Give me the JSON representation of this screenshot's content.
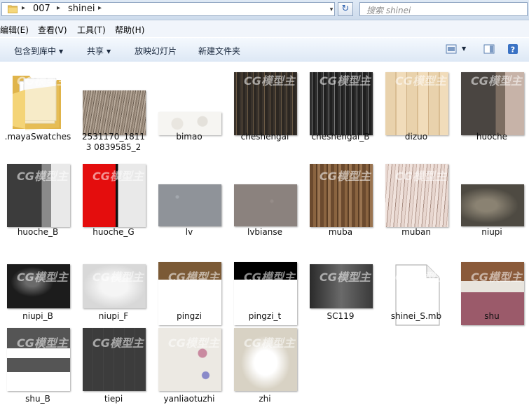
{
  "address": {
    "crumbs": [
      "007",
      "shinei"
    ],
    "separator": "▸",
    "dropdown": "▾",
    "refresh": "↻"
  },
  "search": {
    "placeholder": "搜索 shinei"
  },
  "menu": {
    "items": [
      "编辑(E)",
      "查看(V)",
      "工具(T)",
      "帮助(H)"
    ]
  },
  "toolbar": {
    "include_in_library": "包含到库中",
    "share": "共享",
    "slideshow": "放映幻灯片",
    "new_folder": "新建文件夹",
    "view_icon": "view-options-icon",
    "pane_icon": "preview-pane-icon",
    "help_icon": "help-icon"
  },
  "watermark": "CG模型主",
  "files": [
    {
      "name": ".mayaSwatches",
      "kind": "folder"
    },
    {
      "name": "2531170_18113 0839585_2",
      "kind": "image",
      "texture": "fur"
    },
    {
      "name": "bimao",
      "kind": "image",
      "texture": "bimao"
    },
    {
      "name": "cheshengai",
      "kind": "image",
      "texture": "cheshengai"
    },
    {
      "name": "cheshengai_B",
      "kind": "image",
      "texture": "cheshengai_b"
    },
    {
      "name": "dizuo",
      "kind": "image",
      "texture": "dizuo"
    },
    {
      "name": "huoche",
      "kind": "image",
      "texture": "huoche"
    },
    {
      "name": "huoche_B",
      "kind": "image",
      "texture": "huoche_b"
    },
    {
      "name": "huoche_G",
      "kind": "image",
      "texture": "huoche_g"
    },
    {
      "name": "lv",
      "kind": "image",
      "texture": "lv"
    },
    {
      "name": "lvbianse",
      "kind": "image",
      "texture": "lvbianse"
    },
    {
      "name": "muba",
      "kind": "image",
      "texture": "muba"
    },
    {
      "name": "muban",
      "kind": "image",
      "texture": "muban"
    },
    {
      "name": "niupi",
      "kind": "image",
      "texture": "niupi"
    },
    {
      "name": "niupi_B",
      "kind": "image",
      "texture": "niupi_b"
    },
    {
      "name": "niupi_F",
      "kind": "image",
      "texture": "niupi_f"
    },
    {
      "name": "pingzi",
      "kind": "image",
      "texture": "pingzi"
    },
    {
      "name": "pingzi_t",
      "kind": "image",
      "texture": "pingzi_t"
    },
    {
      "name": "SC119",
      "kind": "image",
      "texture": "sc119"
    },
    {
      "name": "shinei_S.mb",
      "kind": "document"
    },
    {
      "name": "shu",
      "kind": "image",
      "texture": "shu"
    },
    {
      "name": "shu_B",
      "kind": "image",
      "texture": "shu_b"
    },
    {
      "name": "tiepi",
      "kind": "image",
      "texture": "tiepi"
    },
    {
      "name": "yanliaotuzhi",
      "kind": "image",
      "texture": "yanliao"
    },
    {
      "name": "zhi",
      "kind": "image",
      "texture": "zhi"
    }
  ],
  "colors": {
    "toolbar_top": "#f5f9fe",
    "toolbar_bottom": "#dde8f5",
    "menubar": "#f1f5fb",
    "border": "#a9bcd5"
  }
}
